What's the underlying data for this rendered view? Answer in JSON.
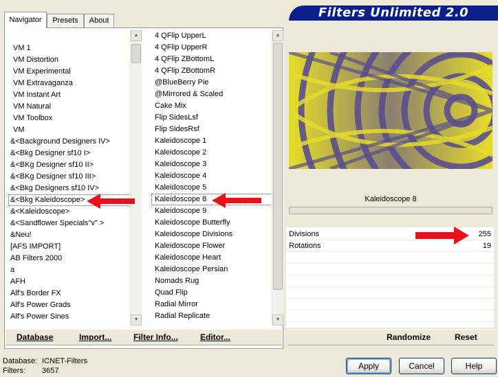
{
  "tabs": [
    {
      "label": "Navigator"
    },
    {
      "label": "Presets"
    },
    {
      "label": "About"
    }
  ],
  "banner": {
    "title": "Filters Unlimited 2.0"
  },
  "categories": [
    "VM 1",
    "VM Distortion",
    "VM Experimental",
    "VM Extravaganza",
    "VM Instant Art",
    "VM Natural",
    "VM Toolbox",
    "VM",
    "&<Background Designers IV>",
    "&<Bkg Designer sf10 I>",
    "&<BKg Designer sf10 II>",
    "&<BKg Designer sf10 III>",
    "&<Bkg Designers sf10 IV>",
    "&<Bkg Kaleidoscope>",
    "&<Kaleidoscope>",
    "&<Sandflower Specials\"v\" >",
    "&Neu!",
    "[AFS IMPORT]",
    "AB Filters 2000",
    "a",
    "AFH",
    "Alf's Border FX",
    "Alf's Power Grads",
    "Alf's Power Sines"
  ],
  "filters": [
    "4 QFlip UpperL",
    "4 QFlip UpperR",
    "4 QFlip ZBottomL",
    "4 QFlip ZBottomR",
    "@BlueBerry Pie",
    "@Mirrored & Scaled",
    "Cake Mix",
    "Flip SidesLsf",
    "Flip SidesRsf",
    "Kaleidoscope 1",
    "Kaleidoscope 2",
    "Kaleidoscope 3",
    "Kaleidoscope 4",
    "Kaleidoscope 5",
    "Kaleidoscope 8",
    "Kaleidoscope 9",
    "Kaleidoscope Butterfly",
    "Kaleidoscope Divisions",
    "Kaleidoscope Flower",
    "Kaleidoscope Heart",
    "Kaleidoscope Persian",
    "Nomads Rug",
    "Quad Flip",
    "Radial Mirror",
    "Radial Replicate"
  ],
  "selected_category": "&<Bkg Kaleidoscope>",
  "selected_filter": "Kaleidoscope 8",
  "bottom_links": {
    "database": "Database",
    "import": "Import...",
    "filter_info": "Filter Info...",
    "editor": "Editor..."
  },
  "preview": {
    "filter_name": "Kaleidoscope 8"
  },
  "params": [
    {
      "name": "Divisions",
      "value": "255"
    },
    {
      "name": "Rotations",
      "value": "19"
    }
  ],
  "right_buttons": {
    "randomize": "Randomize",
    "reset": "Reset"
  },
  "status": {
    "database_label": "Database:",
    "database_value": "ICNET-Filters",
    "filters_label": "Filters:",
    "filters_value": "3657"
  },
  "dialog_buttons": {
    "apply": "Apply",
    "cancel": "Cancel",
    "help": "Help"
  },
  "colors": {
    "banner": "#0a1f8a",
    "arrow": "#e8101a",
    "preview_yellow": "#e6dc2a",
    "preview_purple": "#5a4f8c"
  },
  "icons": {
    "scroll_up": "scroll-up-arrow-icon",
    "scroll_down": "scroll-down-arrow-icon",
    "annotation": "red-arrow-icon"
  }
}
